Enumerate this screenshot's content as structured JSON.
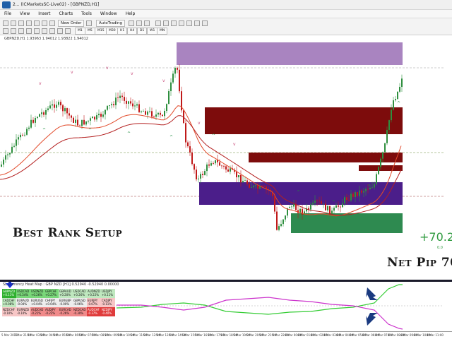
{
  "window": {
    "title": "2... (ICMarketsSC-Live02) - [GBPNZD,H1]"
  },
  "menu": [
    "File",
    "View",
    "Insert",
    "Charts",
    "Tools",
    "Window",
    "Help"
  ],
  "toolbar": {
    "new_order": "New Order",
    "auto_trading": "AutoTrading",
    "timeframes": [
      "M1",
      "M5",
      "M15",
      "M30",
      "H1",
      "H4",
      "D1",
      "W1",
      "MN"
    ]
  },
  "chart": {
    "symbol_line": "GBPNZD,H1  1.93963 1.94012 1.93822 1.94012",
    "overlay_title": "Best Rank Setup",
    "overlay_result": "Net Pip 70",
    "pips_value": "+70.2",
    "pips_sub": "0.0",
    "colors": {
      "bull": "#2f8f3f",
      "bear": "#c01a1a",
      "zone_top": "#9a6fb5",
      "zone_mid": "#4b1e8a",
      "zone_dark_red": "#7d0c0c",
      "zone_green": "#2e8a50",
      "ma_fast": "#e24a2a",
      "ma_slow": "#b42020"
    }
  },
  "subwindow": {
    "header": "SL Currency Heat Map : GBP NZD [H1] 0.52940 -0.52940 0.00000",
    "matrix": [
      [
        "GBPNZD +0.11%",
        "USDCAD +0.34%",
        "USDNZD +0.26%",
        "GBPCHF +0.27%",
        "GBPAUD +0.20%",
        "USDCAD +0.26%",
        "AUDNZD +0.22%",
        "USDJPY +0.11%"
      ],
      [
        "CADCHF +0.08%",
        "EURAUD -0.04%",
        "EURUSD +0.04%",
        "CHFJPY +0.04%",
        "EURGBP -0.00%",
        "GBPUSD -0.06%",
        "EURJPY -0.07%",
        "CADJPY -0.11%"
      ],
      [
        "NZDCHF -0.10%",
        "EURNZD -0.10%",
        "AUDCAD -0.21%",
        "AUDJPY -0.22%",
        "EURCAD -0.26%",
        "NZDCAD -0.30%",
        "AUDCHF -0.37%",
        "NZDJPY -0.40%"
      ]
    ],
    "matrix_classes": [
      [
        "gb",
        "g",
        "g",
        "g",
        "lg",
        "lg",
        "lg",
        "lg"
      ],
      [
        "lg",
        "w",
        "w",
        "w",
        "w",
        "w",
        "lr",
        "lr"
      ],
      [
        "lr",
        "lr",
        "r",
        "r",
        "r",
        "r",
        "rb",
        "rb"
      ]
    ]
  },
  "x_axis_labels": [
    "5 Mar 2021",
    "5 Mar 21:40",
    "5 Mar 03:00",
    "5 Mar 04:00",
    "5 Mar 05:00",
    "5 Mar 06:00",
    "5 Mar 07:00",
    "5 Mar 08:00",
    "5 Mar 09:00",
    "5 Mar 10:00",
    "5 Mar 11:00",
    "5 Mar 12:00",
    "5 Mar 13:00",
    "5 Mar 14:00",
    "5 Mar 15:00",
    "5 Mar 16:00",
    "5 Mar 17:00",
    "5 Mar 18:00",
    "5 Mar 19:00",
    "5 Mar 20:00",
    "5 Mar 21:00",
    "5 Mar 22:00",
    "8 Mar 00:00",
    "8 Mar 01:00",
    "8 Mar 02:00",
    "8 Mar 03:00",
    "8 Mar 04:00",
    "8 Mar 05:00",
    "8 Mar 06:00",
    "8 Mar 07:00",
    "8 Mar 08:00",
    "8 Mar 09:00",
    "8 Mar 10:00",
    "8 Mar 11:00"
  ]
}
